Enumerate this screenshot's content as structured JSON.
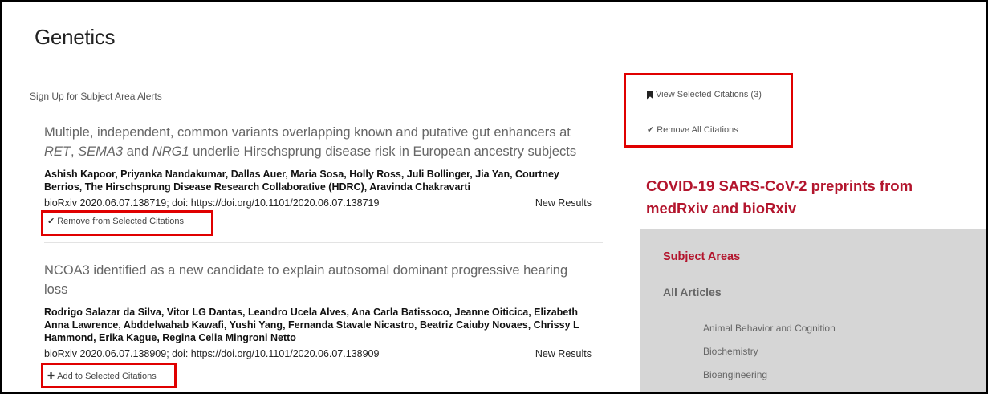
{
  "page": {
    "title": "Genetics",
    "alerts_link": "Sign Up for Subject Area Alerts"
  },
  "articles": [
    {
      "title_part1": "Multiple, independent, common variants overlapping known and putative gut enhancers at",
      "title_ital1": "RET",
      "title_sep1": ", ",
      "title_ital2": "SEMA3",
      "title_sep2": " and ",
      "title_ital3": "NRG1",
      "title_part2": " underlie Hirschsprung disease risk in European ancestry subjects",
      "authors": "Ashish Kapoor, Priyanka Nandakumar, Dallas Auer, Maria Sosa, Holly Ross, Juli Bollinger, Jia Yan, Courtney Berrios, The Hirschsprung Disease Research Collaborative (HDRC), Aravinda Chakravarti",
      "meta": "bioRxiv 2020.06.07.138719; doi: https://doi.org/10.1101/2020.06.07.138719",
      "type": "New Results",
      "citation_action": "Remove from Selected Citations",
      "citation_icon": "checkmark-icon"
    },
    {
      "title": "NCOA3 identified as a new candidate to explain autosomal dominant progressive hearing loss",
      "authors": "Rodrigo Salazar da Silva, Vitor LG Dantas, Leandro Ucela Alves, Ana Carla Batissoco, Jeanne Oiticica, Elizabeth Anna Lawrence, Abddelwahab Kawafi, Yushi Yang, Fernanda Stavale Nicastro, Beatriz Caiuby Novaes, Chrissy L Hammond, Erika Kague, Regina Celia Mingroni Netto",
      "meta": "bioRxiv 2020.06.07.138909; doi: https://doi.org/10.1101/2020.06.07.138909",
      "type": "New Results",
      "citation_action": "Add to Selected Citations",
      "citation_icon": "plus-icon"
    }
  ],
  "sidebar": {
    "view_citations": "View Selected Citations (3)",
    "remove_all": "Remove All Citations",
    "covid_heading": "COVID-19 SARS-CoV-2 preprints from medRxiv and bioRxiv",
    "subject_areas_heading": "Subject Areas",
    "all_articles": "All Articles",
    "subjects": [
      "Animal Behavior and Cognition",
      "Biochemistry",
      "Bioengineering"
    ]
  },
  "colors": {
    "accent": "#b3152d",
    "highlight_box": "#e00000",
    "panel_bg": "#d6d6d6"
  }
}
